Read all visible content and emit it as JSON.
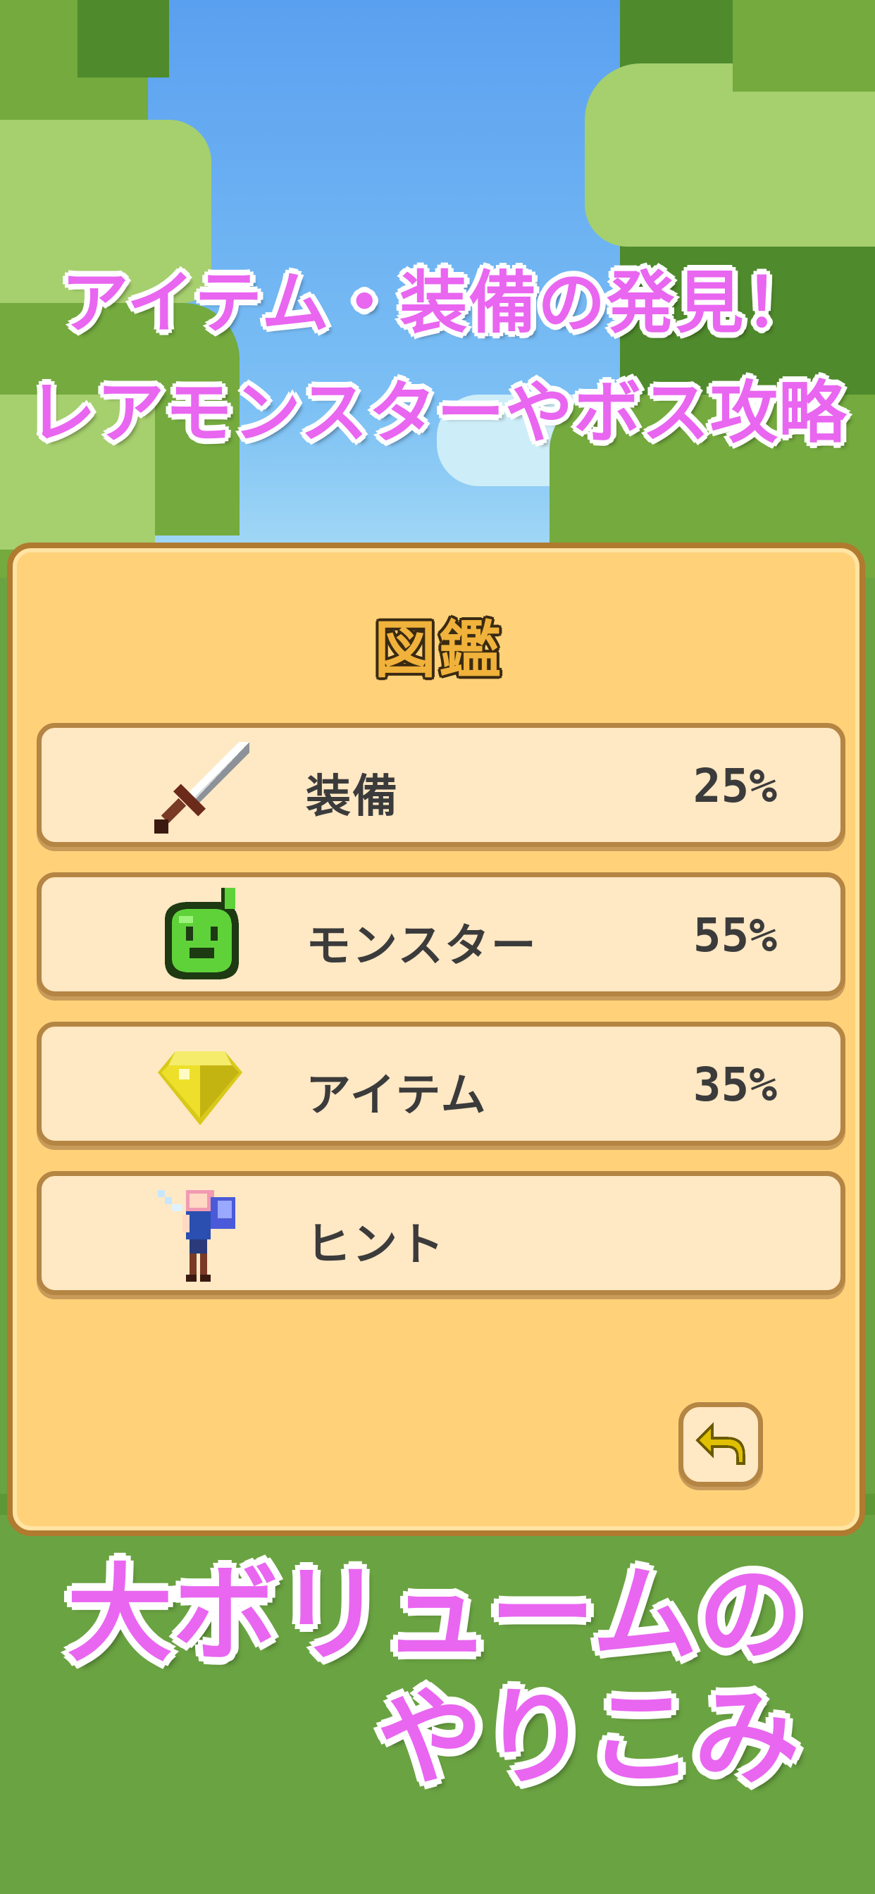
{
  "headline": {
    "line1": "アイテム・装備の発見！",
    "line2": "レアモンスターやボス攻略"
  },
  "panel": {
    "title": "図鑑",
    "rows": [
      {
        "label": "装備",
        "percent": "25%",
        "icon": "sword-icon"
      },
      {
        "label": "モンスター",
        "percent": "55%",
        "icon": "slime-icon"
      },
      {
        "label": "アイテム",
        "percent": "35%",
        "icon": "gem-icon"
      },
      {
        "label": "ヒント",
        "percent": "",
        "icon": "fairy-icon"
      }
    ],
    "back_icon": "back-arrow-icon"
  },
  "bottom_headline": {
    "line1": "大ボリュームの",
    "line2": "やりこみ"
  },
  "colors": {
    "headline": "#e966f0",
    "panel": "#ffd27a",
    "row": "#ffe8c4",
    "border": "#b48543"
  }
}
